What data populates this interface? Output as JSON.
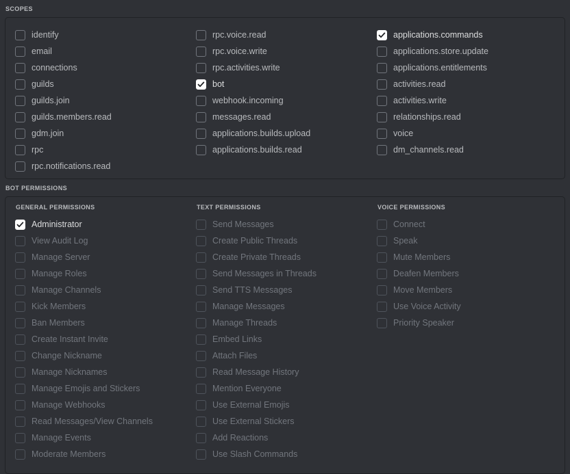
{
  "colors": {
    "background": "#2f3136",
    "panel_border": "#202225",
    "label": "#b9bbbe",
    "label_disabled": "#72767d",
    "label_active": "#dcddde",
    "checkbox_checked_bg": "#ffffff",
    "checkmark": "#202225"
  },
  "scopes": {
    "section_title": "SCOPES",
    "columns": [
      {
        "items": [
          {
            "label": "identify",
            "checked": false,
            "disabled": false
          },
          {
            "label": "email",
            "checked": false,
            "disabled": false
          },
          {
            "label": "connections",
            "checked": false,
            "disabled": false
          },
          {
            "label": "guilds",
            "checked": false,
            "disabled": false
          },
          {
            "label": "guilds.join",
            "checked": false,
            "disabled": false
          },
          {
            "label": "guilds.members.read",
            "checked": false,
            "disabled": false
          },
          {
            "label": "gdm.join",
            "checked": false,
            "disabled": false
          },
          {
            "label": "rpc",
            "checked": false,
            "disabled": false
          },
          {
            "label": "rpc.notifications.read",
            "checked": false,
            "disabled": false
          }
        ]
      },
      {
        "items": [
          {
            "label": "rpc.voice.read",
            "checked": false,
            "disabled": false
          },
          {
            "label": "rpc.voice.write",
            "checked": false,
            "disabled": false
          },
          {
            "label": "rpc.activities.write",
            "checked": false,
            "disabled": false
          },
          {
            "label": "bot",
            "checked": true,
            "disabled": false
          },
          {
            "label": "webhook.incoming",
            "checked": false,
            "disabled": false
          },
          {
            "label": "messages.read",
            "checked": false,
            "disabled": false
          },
          {
            "label": "applications.builds.upload",
            "checked": false,
            "disabled": false
          },
          {
            "label": "applications.builds.read",
            "checked": false,
            "disabled": false
          }
        ]
      },
      {
        "items": [
          {
            "label": "applications.commands",
            "checked": true,
            "disabled": false
          },
          {
            "label": "applications.store.update",
            "checked": false,
            "disabled": false
          },
          {
            "label": "applications.entitlements",
            "checked": false,
            "disabled": false
          },
          {
            "label": "activities.read",
            "checked": false,
            "disabled": false
          },
          {
            "label": "activities.write",
            "checked": false,
            "disabled": false
          },
          {
            "label": "relationships.read",
            "checked": false,
            "disabled": false
          },
          {
            "label": "voice",
            "checked": false,
            "disabled": false
          },
          {
            "label": "dm_channels.read",
            "checked": false,
            "disabled": false
          }
        ]
      }
    ]
  },
  "bot_permissions": {
    "section_title": "BOT PERMISSIONS",
    "columns": [
      {
        "heading": "GENERAL PERMISSIONS",
        "items": [
          {
            "label": "Administrator",
            "checked": true,
            "disabled": false
          },
          {
            "label": "View Audit Log",
            "checked": false,
            "disabled": true
          },
          {
            "label": "Manage Server",
            "checked": false,
            "disabled": true
          },
          {
            "label": "Manage Roles",
            "checked": false,
            "disabled": true
          },
          {
            "label": "Manage Channels",
            "checked": false,
            "disabled": true
          },
          {
            "label": "Kick Members",
            "checked": false,
            "disabled": true
          },
          {
            "label": "Ban Members",
            "checked": false,
            "disabled": true
          },
          {
            "label": "Create Instant Invite",
            "checked": false,
            "disabled": true
          },
          {
            "label": "Change Nickname",
            "checked": false,
            "disabled": true
          },
          {
            "label": "Manage Nicknames",
            "checked": false,
            "disabled": true
          },
          {
            "label": "Manage Emojis and Stickers",
            "checked": false,
            "disabled": true
          },
          {
            "label": "Manage Webhooks",
            "checked": false,
            "disabled": true
          },
          {
            "label": "Read Messages/View Channels",
            "checked": false,
            "disabled": true
          },
          {
            "label": "Manage Events",
            "checked": false,
            "disabled": true
          },
          {
            "label": "Moderate Members",
            "checked": false,
            "disabled": true
          }
        ]
      },
      {
        "heading": "TEXT PERMISSIONS",
        "items": [
          {
            "label": "Send Messages",
            "checked": false,
            "disabled": true
          },
          {
            "label": "Create Public Threads",
            "checked": false,
            "disabled": true
          },
          {
            "label": "Create Private Threads",
            "checked": false,
            "disabled": true
          },
          {
            "label": "Send Messages in Threads",
            "checked": false,
            "disabled": true
          },
          {
            "label": "Send TTS Messages",
            "checked": false,
            "disabled": true
          },
          {
            "label": "Manage Messages",
            "checked": false,
            "disabled": true
          },
          {
            "label": "Manage Threads",
            "checked": false,
            "disabled": true
          },
          {
            "label": "Embed Links",
            "checked": false,
            "disabled": true
          },
          {
            "label": "Attach Files",
            "checked": false,
            "disabled": true
          },
          {
            "label": "Read Message History",
            "checked": false,
            "disabled": true
          },
          {
            "label": "Mention Everyone",
            "checked": false,
            "disabled": true
          },
          {
            "label": "Use External Emojis",
            "checked": false,
            "disabled": true
          },
          {
            "label": "Use External Stickers",
            "checked": false,
            "disabled": true
          },
          {
            "label": "Add Reactions",
            "checked": false,
            "disabled": true
          },
          {
            "label": "Use Slash Commands",
            "checked": false,
            "disabled": true
          }
        ]
      },
      {
        "heading": "VOICE PERMISSIONS",
        "items": [
          {
            "label": "Connect",
            "checked": false,
            "disabled": true
          },
          {
            "label": "Speak",
            "checked": false,
            "disabled": true
          },
          {
            "label": "Mute Members",
            "checked": false,
            "disabled": true
          },
          {
            "label": "Deafen Members",
            "checked": false,
            "disabled": true
          },
          {
            "label": "Move Members",
            "checked": false,
            "disabled": true
          },
          {
            "label": "Use Voice Activity",
            "checked": false,
            "disabled": true
          },
          {
            "label": "Priority Speaker",
            "checked": false,
            "disabled": true
          }
        ]
      }
    ]
  }
}
